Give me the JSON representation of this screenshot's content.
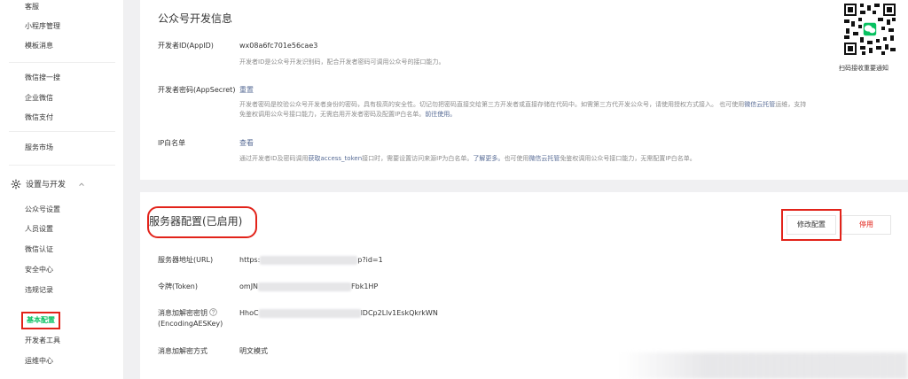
{
  "sidebar": {
    "items_top": [
      {
        "id": "kefu",
        "label": "客服"
      },
      {
        "id": "miniprogram",
        "label": "小程序管理"
      },
      {
        "id": "template",
        "label": "模板消息"
      },
      {
        "id": "search",
        "label": "微信搜一搜"
      },
      {
        "id": "work",
        "label": "企业微信"
      },
      {
        "id": "pay",
        "label": "微信支付"
      },
      {
        "id": "market",
        "label": "服务市场"
      }
    ],
    "group": {
      "label": "设置与开发",
      "icon": "gear-icon",
      "chevron": "chevron-up-icon"
    },
    "items_group": [
      {
        "id": "account-settings",
        "label": "公众号设置"
      },
      {
        "id": "staff",
        "label": "人员设置"
      },
      {
        "id": "verify",
        "label": "微信认证"
      },
      {
        "id": "security",
        "label": "安全中心"
      },
      {
        "id": "violation",
        "label": "违规记录"
      },
      {
        "id": "basic-config",
        "label": "基本配置",
        "active": true
      },
      {
        "id": "dev-tools",
        "label": "开发者工具"
      },
      {
        "id": "ops",
        "label": "运维中心"
      }
    ]
  },
  "dev_info": {
    "title": "公众号开发信息",
    "appid": {
      "label": "开发者ID(AppID)",
      "value": "wx08a6fc701e56cae3",
      "desc": "开发者ID是公众号开发识别码，配合开发者密码可调用公众号的接口能力。"
    },
    "secret": {
      "label": "开发者密码(AppSecret)",
      "action": "重置",
      "desc_1": "开发者密码是校验公众号开发者身份的密码，具有极高的安全性。切记勿把密码直接交给第三方开发者或直接存储在代码中。如需第三方代开发公众号，请使用授权方式接入。 也可使用",
      "desc_link_1": "微信云托管",
      "desc_2": "免鉴权调用公众号接口能力，无需启用开发者密码及配置IP白名单。",
      "desc_link_2": "前往使用。",
      "desc_prefix_2": "运维，支持"
    },
    "ip": {
      "label": "IP白名单",
      "action": "查看",
      "desc_1": "通过开发者ID及密码调用",
      "desc_link_1": "获取access_token",
      "desc_2": "接口时，需要设置访问来源IP为白名单。",
      "desc_link_2": "了解更多。",
      "desc_3": "也可使用",
      "desc_link_3": "微信云托管",
      "desc_4": "免鉴权调用公众号接口能力，无需配置IP白名单。"
    }
  },
  "qr": {
    "label": "扫码接收重要通知"
  },
  "server": {
    "title": "服务器配置(已启用)",
    "edit_button": "修改配置",
    "stop_button": "停用",
    "url": {
      "label": "服务器地址(URL)",
      "prefix": "https:",
      "suffix": "p?id=1"
    },
    "token": {
      "label": "令牌(Token)",
      "prefix": "omJN",
      "suffix": "Fbk1HP"
    },
    "aeskey": {
      "label_1": "消息加解密密钥",
      "label_2": "(EncodingAESKey)",
      "prefix": "HhoC",
      "suffix": "lDCp2Llv1EskQkrkWN"
    },
    "mode": {
      "label": "消息加解密方式",
      "value": "明文模式"
    }
  },
  "colors": {
    "accent": "#07c160",
    "link": "#576b95",
    "highlight": "#e2231a",
    "danger": "#e2231a"
  }
}
